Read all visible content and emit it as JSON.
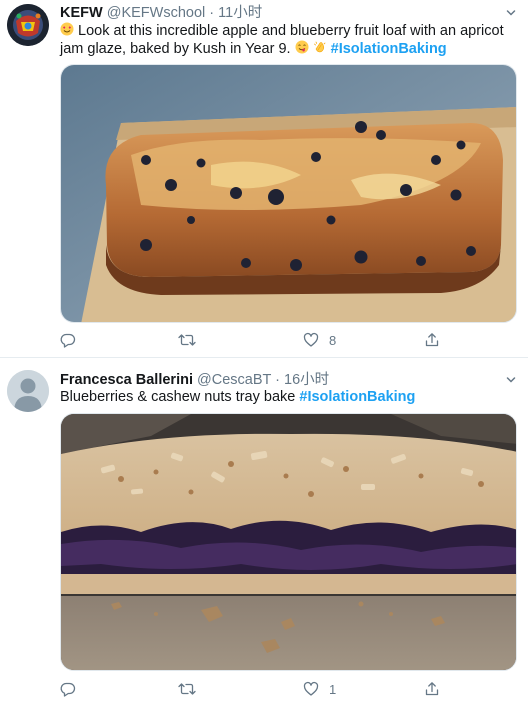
{
  "tweets": [
    {
      "display_name": "KEFW",
      "handle": "@KEFWschool",
      "separator": "·",
      "time": "11小时",
      "text_pre": " Look at this incredible apple and blueberry fruit loaf with an apricot jam glaze, baked by Kush in Year 9. ",
      "hashtag": "#IsolationBaking",
      "emojis": [
        "smiling-face-hearts",
        "face-savoring-food",
        "clapping-hands"
      ],
      "image_alt": "apple and blueberry fruit loaf with apricot jam glaze on a wooden board",
      "actions": {
        "reply_count": "",
        "retweet_count": "",
        "like_count": "8",
        "share_label": ""
      }
    },
    {
      "display_name": "Francesca Ballerini",
      "handle": "@CescaBT",
      "separator": "·",
      "time": "16小时",
      "text_pre": "Blueberries & cashew nuts tray bake ",
      "hashtag": "#IsolationBaking",
      "image_alt": "blueberry and cashew nut tray bake on baking paper",
      "actions": {
        "reply_count": "",
        "retweet_count": "",
        "like_count": "1",
        "share_label": ""
      }
    }
  ],
  "colors": {
    "link": "#1da1f2",
    "text": "#14171a",
    "secondary": "#657786",
    "divider": "#e6ecf0"
  },
  "icons": [
    "chevron-down-icon",
    "reply-icon",
    "retweet-icon",
    "like-icon",
    "share-icon"
  ]
}
